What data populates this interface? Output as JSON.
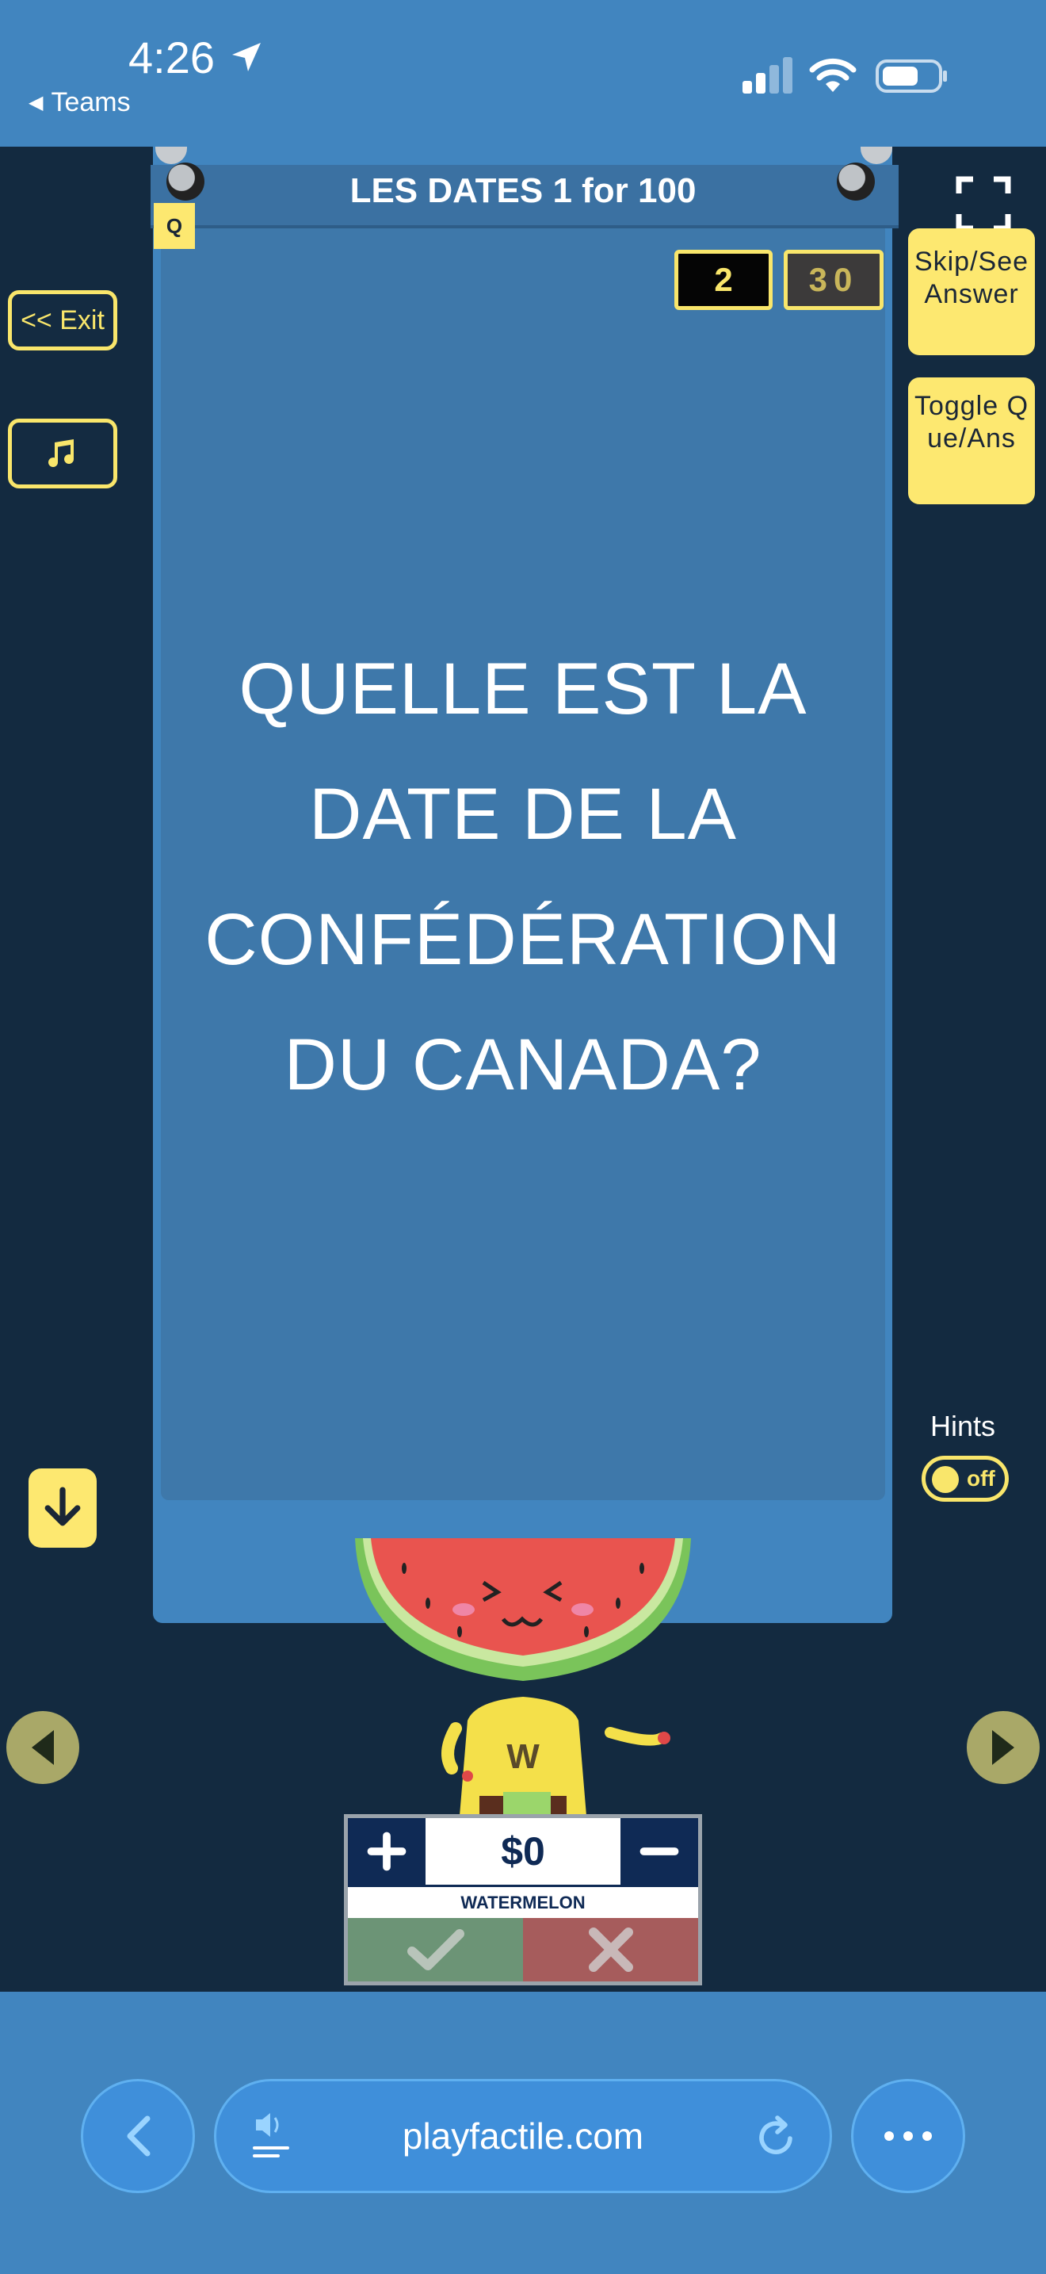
{
  "status_bar": {
    "time": "4:26",
    "back_app_label": "Teams"
  },
  "game": {
    "title": "LES DATES 1 for 100",
    "card_badge": "Q",
    "player_count": "2",
    "timer": "30",
    "question": "QUELLE EST LA DATE DE LA CONFÉDÉRATION DU CANADA?"
  },
  "controls": {
    "exit_label": "<< Exit",
    "skip_label": "Skip/See Answer",
    "toggle_label": "Toggle Que/Ans",
    "hints_label": "Hints",
    "hints_state": "off"
  },
  "team": {
    "score": "$0",
    "name": "WATERMELON",
    "mascot_letter": "W"
  },
  "browser": {
    "url": "playfactile.com"
  },
  "colors": {
    "accent_yellow": "#fde870",
    "card_blue": "#4185bf",
    "background_navy": "#132a40"
  }
}
